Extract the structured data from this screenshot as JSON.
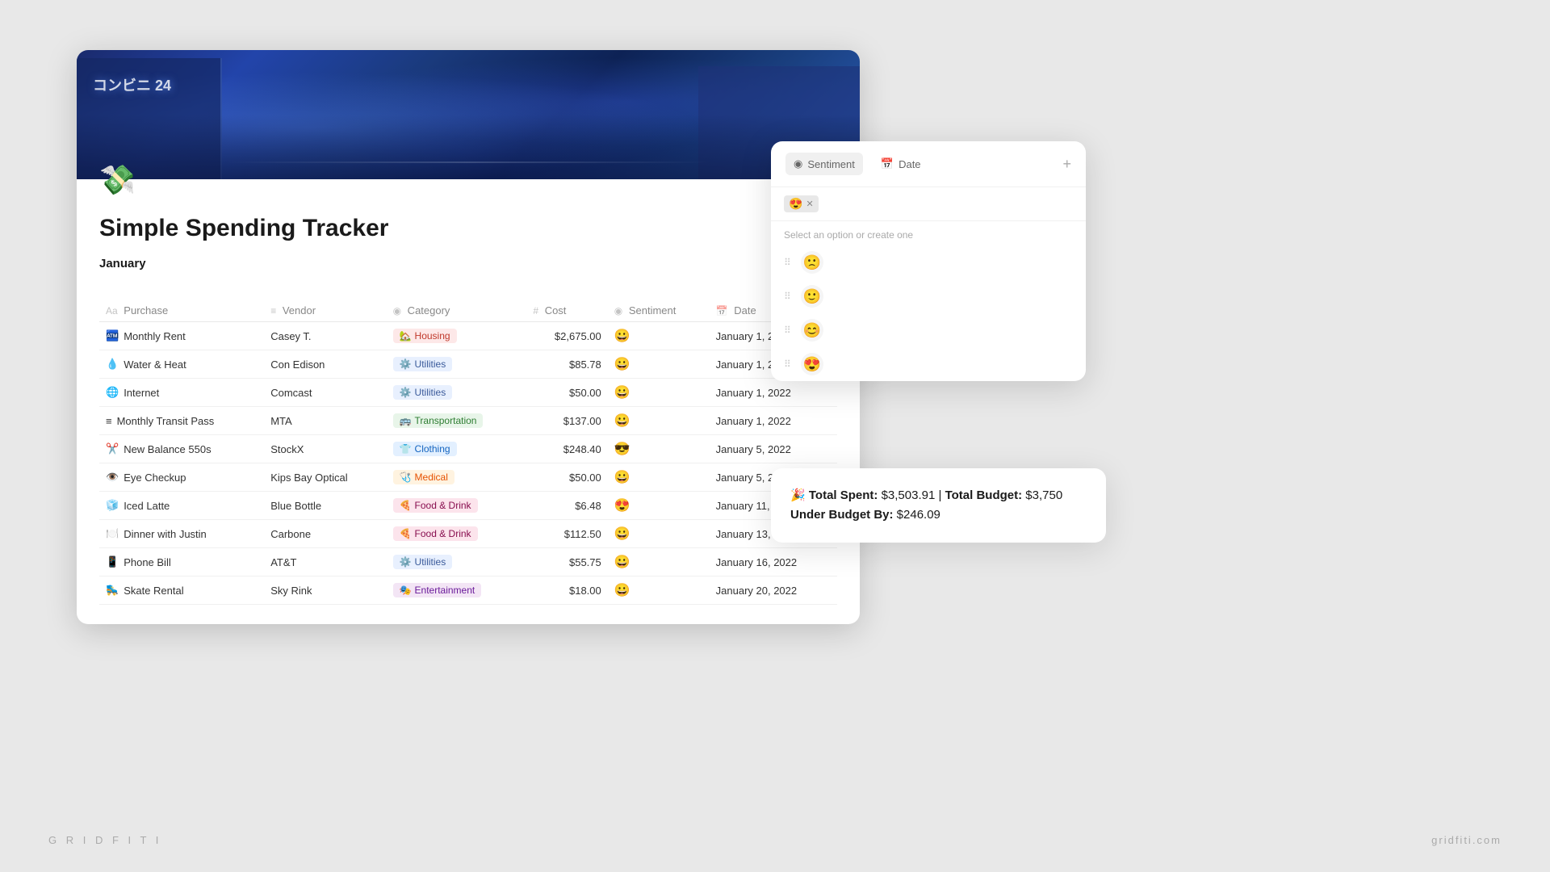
{
  "watermark": {
    "left": "G R I D F I T I",
    "right": "gridfiti.com"
  },
  "notion": {
    "title": "Simple Spending Tracker",
    "icon": "💸",
    "section": "January",
    "columns": [
      {
        "id": "purchase",
        "label": "Purchase",
        "icon": "Aa"
      },
      {
        "id": "vendor",
        "label": "Vendor",
        "icon": "≡"
      },
      {
        "id": "category",
        "label": "Category",
        "icon": "◉"
      },
      {
        "id": "cost",
        "label": "Cost",
        "icon": "#"
      },
      {
        "id": "sentiment",
        "label": "Sentiment",
        "icon": "◉"
      },
      {
        "id": "date",
        "label": "Date",
        "icon": "📅"
      }
    ],
    "rows": [
      {
        "purchase_icon": "🏧",
        "purchase": "Monthly Rent",
        "vendor": "Casey T.",
        "category": "Housing",
        "category_icon": "🏡",
        "category_class": "cat-housing",
        "cost": "$2,675.00",
        "sentiment": "😀",
        "date": "January 1, 2022"
      },
      {
        "purchase_icon": "💧",
        "purchase": "Water & Heat",
        "vendor": "Con Edison",
        "category": "Utilities",
        "category_icon": "⚙️",
        "category_class": "cat-utilities",
        "cost": "$85.78",
        "sentiment": "😀",
        "date": "January 1, 2022"
      },
      {
        "purchase_icon": "🌐",
        "purchase": "Internet",
        "vendor": "Comcast",
        "category": "Utilities",
        "category_icon": "⚙️",
        "category_class": "cat-utilities",
        "cost": "$50.00",
        "sentiment": "😀",
        "date": "January 1, 2022"
      },
      {
        "purchase_icon": "≡",
        "purchase": "Monthly Transit Pass",
        "vendor": "MTA",
        "category": "Transportation",
        "category_icon": "🚌",
        "category_class": "cat-transport",
        "cost": "$137.00",
        "sentiment": "😀",
        "date": "January 1, 2022"
      },
      {
        "purchase_icon": "✂️",
        "purchase": "New Balance 550s",
        "vendor": "StockX",
        "category": "Clothing",
        "category_icon": "👕",
        "category_class": "cat-clothing",
        "cost": "$248.40",
        "sentiment": "😎",
        "date": "January 5, 2022"
      },
      {
        "purchase_icon": "👁️",
        "purchase": "Eye Checkup",
        "vendor": "Kips Bay Optical",
        "category": "Medical",
        "category_icon": "🩺",
        "category_class": "cat-medical",
        "cost": "$50.00",
        "sentiment": "😀",
        "date": "January 5, 2022"
      },
      {
        "purchase_icon": "🧊",
        "purchase": "Iced Latte",
        "vendor": "Blue Bottle",
        "category": "Food & Drink",
        "category_icon": "🍕",
        "category_class": "cat-food",
        "cost": "$6.48",
        "sentiment": "😍",
        "date": "January 11, 2022"
      },
      {
        "purchase_icon": "🍽️",
        "purchase": "Dinner with Justin",
        "vendor": "Carbone",
        "category": "Food & Drink",
        "category_icon": "🍕",
        "category_class": "cat-food",
        "cost": "$112.50",
        "sentiment": "😀",
        "date": "January 13, 2022"
      },
      {
        "purchase_icon": "📱",
        "purchase": "Phone Bill",
        "vendor": "AT&T",
        "category": "Utilities",
        "category_icon": "⚙️",
        "category_class": "cat-utilities",
        "cost": "$55.75",
        "sentiment": "😀",
        "date": "January 16, 2022"
      },
      {
        "purchase_icon": "🛼",
        "purchase": "Skate Rental",
        "vendor": "Sky Rink",
        "category": "Entertainment",
        "category_icon": "🎭",
        "category_class": "cat-entertainment",
        "cost": "$18.00",
        "sentiment": "😀",
        "date": "January 20, 2022"
      }
    ]
  },
  "dropdown": {
    "title": "Sentiment",
    "date_label": "Date",
    "hint": "Select an option or create one",
    "current_tag": "😍",
    "options": [
      {
        "emoji": "🙁",
        "label": ""
      },
      {
        "emoji": "🙂",
        "label": ""
      },
      {
        "emoji": "😊",
        "label": ""
      },
      {
        "emoji": "😍",
        "label": ""
      }
    ]
  },
  "budget": {
    "icon": "🎉",
    "total_spent_label": "Total Spent:",
    "total_spent_value": "$3,503.91",
    "separator": "|",
    "total_budget_label": "Total Budget:",
    "total_budget_value": "$3,750",
    "under_label": "Under Budget By:",
    "under_value": "$246.09"
  }
}
